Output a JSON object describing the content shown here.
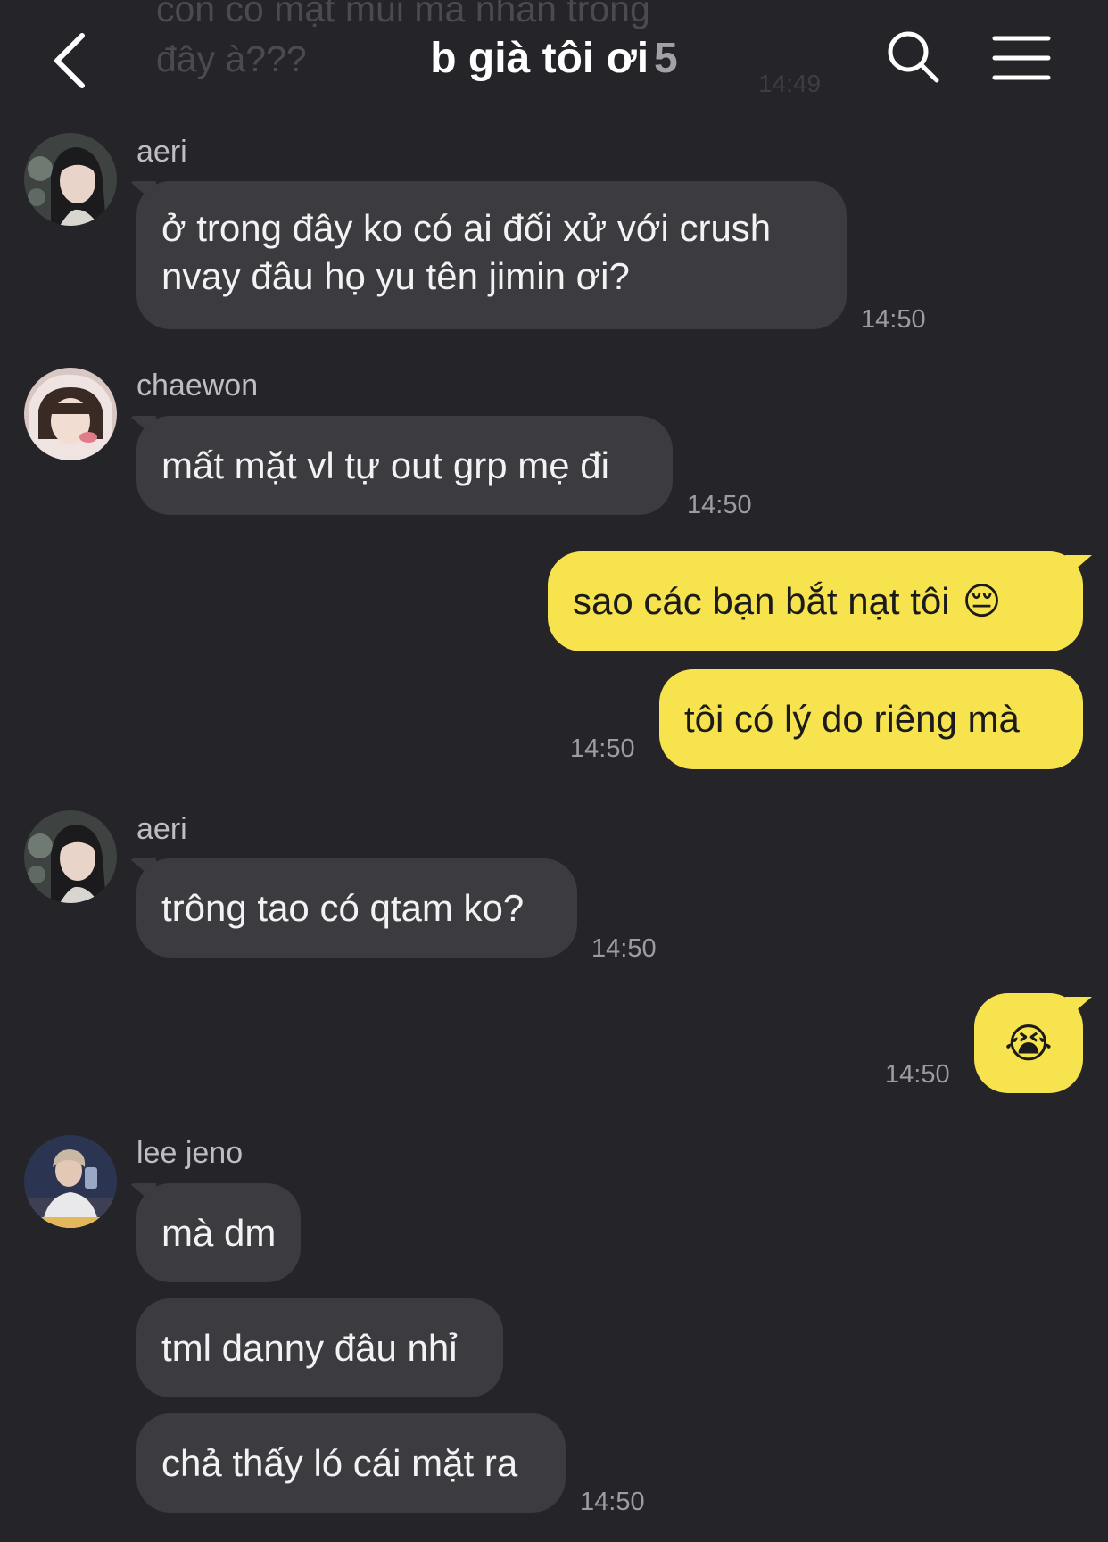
{
  "previous_message": {
    "line1": "còn có mặt mũi mà nhắn trong",
    "line2": "đây à???",
    "time": "14:49"
  },
  "header": {
    "title": "b già tôi ơi",
    "member_count": "5",
    "icons": [
      "back-arrow-icon",
      "search-icon",
      "menu-icon"
    ]
  },
  "colors": {
    "background": "#252529",
    "incoming_bubble": "#3b3b40",
    "outgoing_bubble": "#f7e34d"
  },
  "messages": [
    {
      "sender": "aeri",
      "text": "ở trong đây ko có ai đối xử với crush nvay đâu họ yu tên jimin ơi?",
      "time": "14:50"
    },
    {
      "sender": "chaewon",
      "text": "mất mặt vl tự out grp mẹ đi",
      "time": "14:50"
    },
    {
      "sender": "me",
      "text": "sao các bạn bắt nạt tôi",
      "emoji": "😔"
    },
    {
      "sender": "me",
      "text": "tôi có lý do riêng mà",
      "time": "14:50"
    },
    {
      "sender": "aeri",
      "text": "trông tao có qtam ko?",
      "time": "14:50"
    },
    {
      "sender": "me",
      "emoji": "😭",
      "time": "14:50"
    },
    {
      "sender": "lee jeno",
      "text": "mà dm"
    },
    {
      "sender": "lee jeno",
      "text": "tml danny đâu nhỉ"
    },
    {
      "sender": "lee jeno",
      "text": "chả thấy ló cái mặt ra",
      "time": "14:50"
    }
  ]
}
